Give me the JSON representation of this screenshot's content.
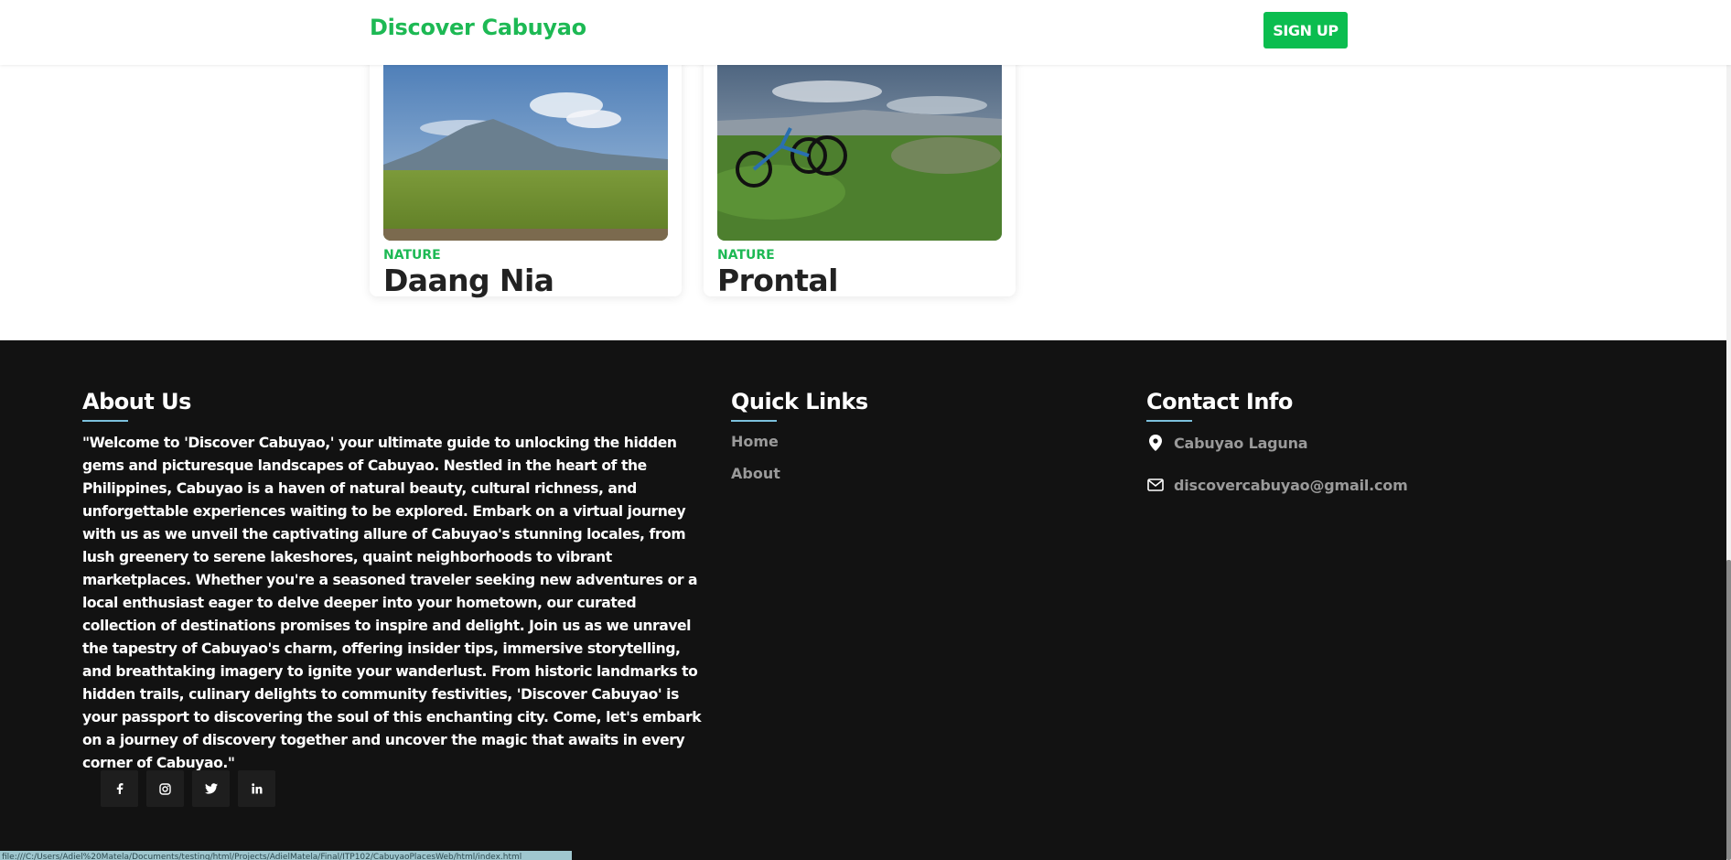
{
  "header": {
    "brand": "Discover Cabuyao",
    "signup_label": "SIGN UP"
  },
  "cards": [
    {
      "category": "NATURE",
      "title": "Daang Nia"
    },
    {
      "category": "NATURE",
      "title": "Prontal"
    }
  ],
  "footer": {
    "about": {
      "title": "About Us",
      "text": "\"Welcome to 'Discover Cabuyao,' your ultimate guide to unlocking the hidden gems and picturesque landscapes of Cabuyao. Nestled in the heart of the Philippines, Cabuyao is a haven of natural beauty, cultural richness, and unforgettable experiences waiting to be explored. Embark on a virtual journey with us as we unveil the captivating allure of Cabuyao's stunning locales, from lush greenery to serene lakeshores, quaint neighborhoods to vibrant marketplaces. Whether you're a seasoned traveler seeking new adventures or a local enthusiast eager to delve deeper into your hometown, our curated collection of destinations promises to inspire and delight. Join us as we unravel the tapestry of Cabuyao's charm, offering insider tips, immersive storytelling, and breathtaking imagery to ignite your wanderlust. From historic landmarks to hidden trails, culinary delights to community festivities, 'Discover Cabuyao' is your passport to discovering the soul of this enchanting city. Come, let's embark on a journey of discovery together and uncover the magic that awaits in every corner of Cabuyao.\""
    },
    "quick_links": {
      "title": "Quick Links",
      "items": [
        "Home",
        "About"
      ]
    },
    "contact": {
      "title": "Contact Info",
      "location": "Cabuyao Laguna",
      "email": "discovercabuyao@gmail.com"
    },
    "social_icons": [
      "facebook-icon",
      "instagram-icon",
      "twitter-icon",
      "linkedin-icon"
    ]
  },
  "status_bar": {
    "url": "file:///C:/Users/Adiel%20Matela/Documents/testing/html/Projects/AdielMatela/Final/ITP102/CabuyaoPlacesWeb/html/index.html"
  },
  "colors": {
    "brand": "#1db954",
    "button": "#0bbd4f",
    "footer_bg": "#121212",
    "accent_underline": "#7cc1dd",
    "muted_text": "#9a9a9a"
  }
}
